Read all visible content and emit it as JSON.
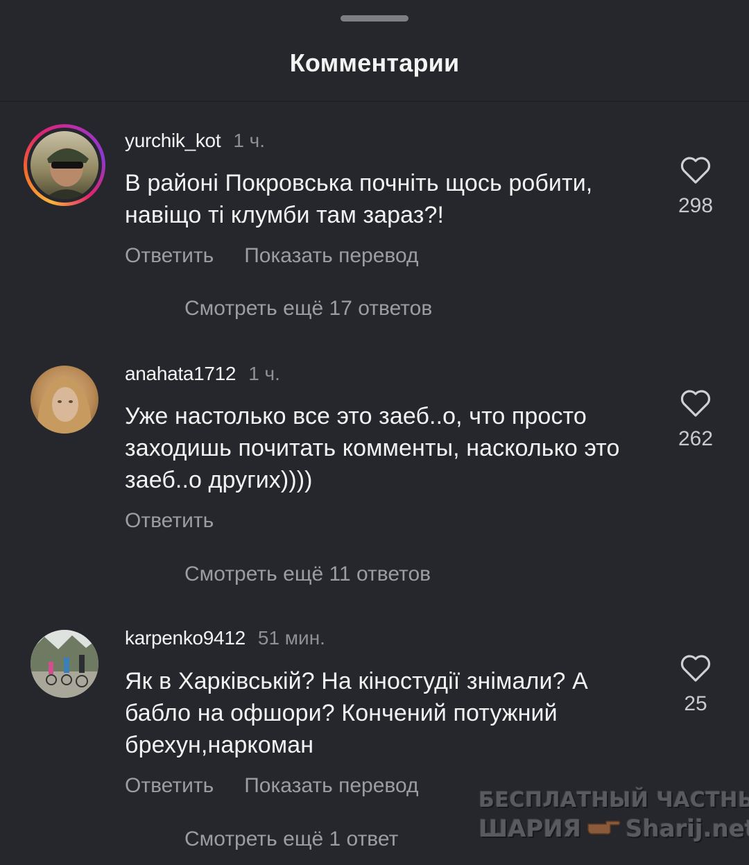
{
  "sheet": {
    "title": "Комментарии"
  },
  "comments": [
    {
      "username": "yurchik_kot",
      "time": "1 ч.",
      "text": "В районі Покровська почніть щось робити, навіщо ті клумби там зараз?!",
      "likes": "298",
      "reply_label": "Ответить",
      "translate_label": "Показать перевод",
      "more_replies": "Смотреть ещё 17 ответов",
      "has_story_ring": true
    },
    {
      "username": "anahata1712",
      "time": "1 ч.",
      "text": "Уже настолько все это заеб..о, что просто заходишь почитать комменты, насколько это заеб..о других))))",
      "likes": "262",
      "reply_label": "Ответить",
      "more_replies": "Смотреть ещё 11 ответов",
      "has_story_ring": false
    },
    {
      "username": "karpenko9412",
      "time": "51 мин.",
      "text": "Як в Харківській? На кіностудії знімали? А бабло на офшори? Кончений потужний брехун,наркоман",
      "likes": "25",
      "reply_label": "Ответить",
      "translate_label": "Показать перевод",
      "more_replies": "Смотреть ещё 1 ответ",
      "has_story_ring": false
    }
  ],
  "watermark": {
    "line1": "БЕСПЛАТНЫЙ ЧАСТНЫЙ",
    "line2_left": "ШАРИЯ",
    "line2_right": "Sharij.net"
  },
  "icons": {
    "like": "heart-outline-icon",
    "drag": "drag-handle"
  },
  "colors": {
    "background": "#25272c",
    "text_primary": "#f2f2f2",
    "text_secondary": "#9b9da2"
  }
}
